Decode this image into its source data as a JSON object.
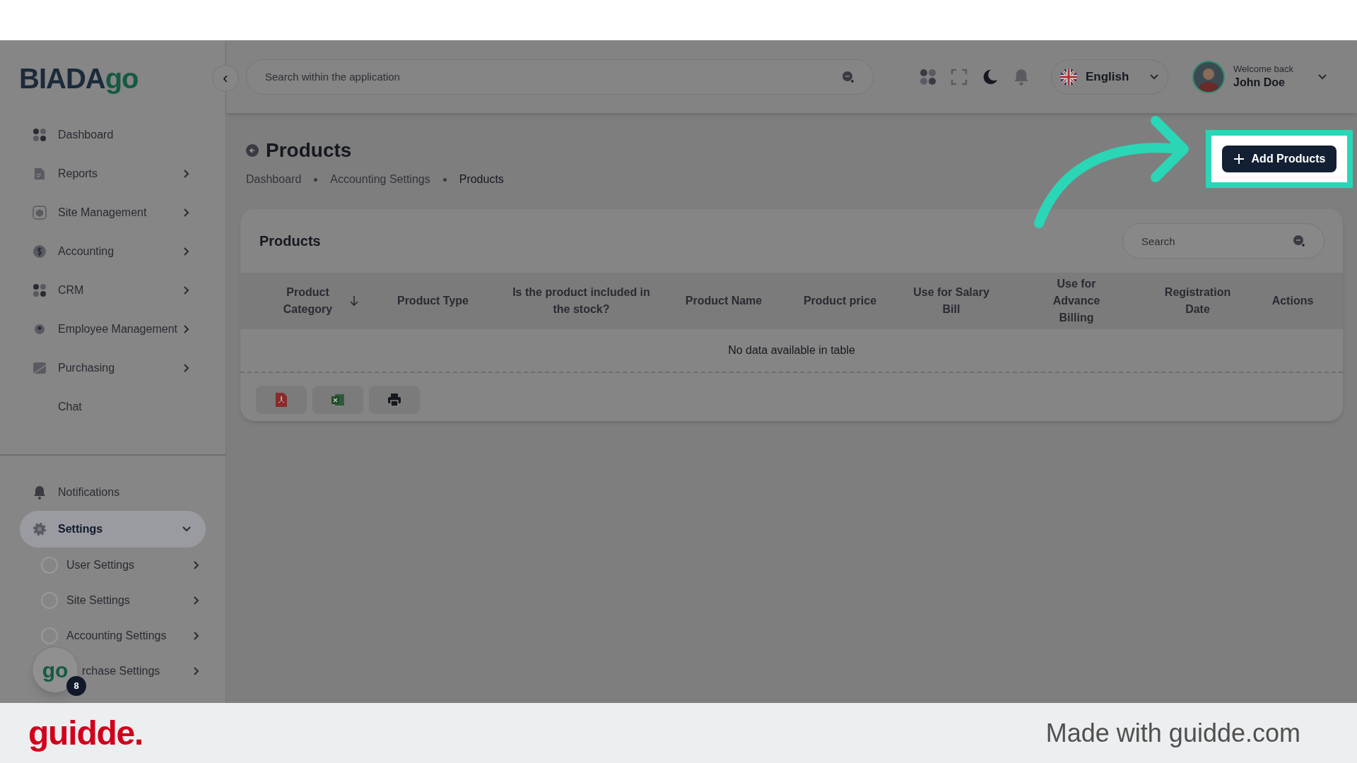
{
  "sidebar": {
    "logo": {
      "dark": "BIADA",
      "accent": "go"
    },
    "collapse_icon": "‹",
    "items": [
      {
        "label": "Dashboard",
        "chevron": false
      },
      {
        "label": "Reports",
        "chevron": true
      },
      {
        "label": "Site Management",
        "chevron": true
      },
      {
        "label": "Accounting",
        "chevron": true
      },
      {
        "label": "CRM",
        "chevron": true
      },
      {
        "label": "Employee Management",
        "chevron": true
      },
      {
        "label": "Purchasing",
        "chevron": true
      },
      {
        "label": "Chat",
        "chevron": false
      }
    ],
    "bottom_items": [
      {
        "label": "Notifications",
        "selected": false
      },
      {
        "label": "Settings",
        "selected": true,
        "expanded": true,
        "children": [
          {
            "label": "User Settings"
          },
          {
            "label": "Site Settings"
          },
          {
            "label": "Accounting Settings"
          },
          {
            "label": "rchase Settings"
          }
        ]
      }
    ],
    "chat_bubble": {
      "logo": "go",
      "badge": "8"
    }
  },
  "header": {
    "search": {
      "placeholder": "Search within the application"
    },
    "language": "English",
    "user": {
      "greeting": "Welcome back",
      "name": "John Doe"
    }
  },
  "page": {
    "title": "Products",
    "breadcrumb": [
      {
        "label": "Dashboard",
        "selected": false
      },
      {
        "label": "Accounting Settings",
        "selected": false
      },
      {
        "label": "Products",
        "selected": true
      }
    ],
    "add_button": "Add Products"
  },
  "card": {
    "title": "Products",
    "search": {
      "placeholder": "Search"
    },
    "table": {
      "columns": [
        "Product Category",
        "Product Type",
        "Is the product included in the stock?",
        "Product Name",
        "Product price",
        "Use for Salary Bill",
        "Use for Advance Billing",
        "Registration Date",
        "Actions"
      ],
      "empty_message": "No data available in table"
    },
    "export_buttons": [
      {
        "kind": "pdf"
      },
      {
        "kind": "excel"
      },
      {
        "kind": "print"
      }
    ]
  },
  "footer": {
    "brand": "guidde.",
    "credit": "Made with guidde.com"
  }
}
